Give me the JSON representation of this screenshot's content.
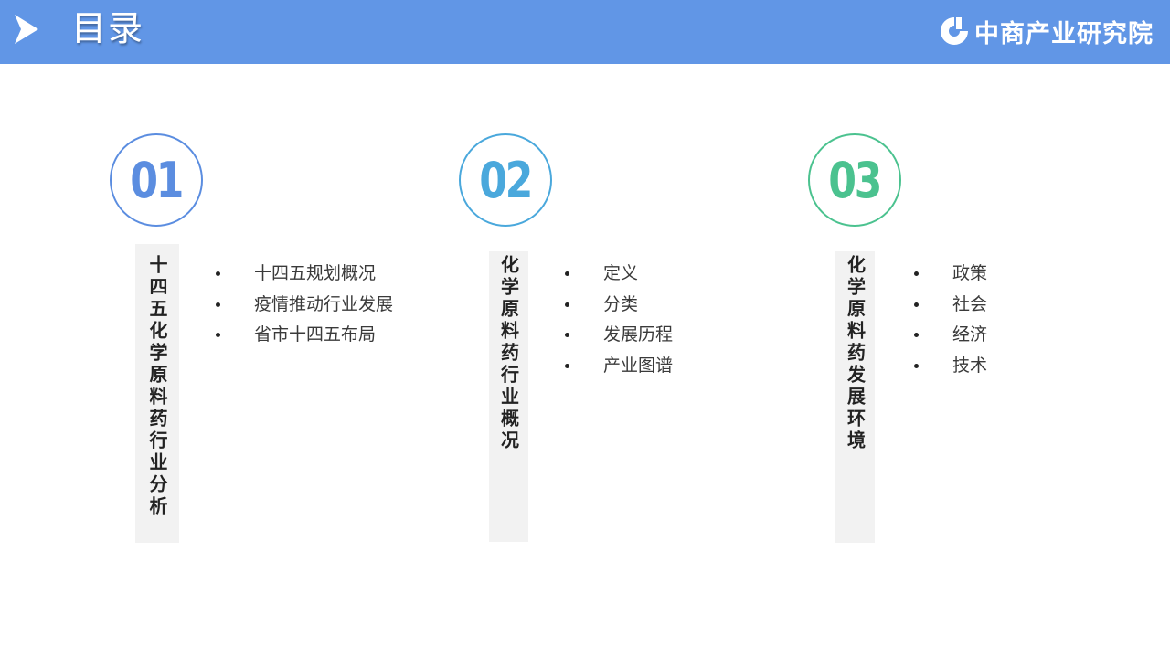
{
  "header": {
    "title": "目录",
    "logo_text": "中商产业研究院",
    "bg_color": "#6196e6"
  },
  "sections": [
    {
      "number": "01",
      "color": "#5b8de0",
      "heading": "十四五化学原料药行业分析",
      "items": [
        "十四五规划概况",
        "疫情推动行业发展",
        "省市十四五布局"
      ]
    },
    {
      "number": "02",
      "color": "#4aa8dc",
      "heading": "化学原料药行业概况",
      "items": [
        "定义",
        "分类",
        "发展历程",
        "产业图谱"
      ]
    },
    {
      "number": "03",
      "color": "#4bc28f",
      "heading": "化学原料药发展环境",
      "items": [
        "政策",
        "社会",
        "经济",
        "技术"
      ]
    }
  ]
}
